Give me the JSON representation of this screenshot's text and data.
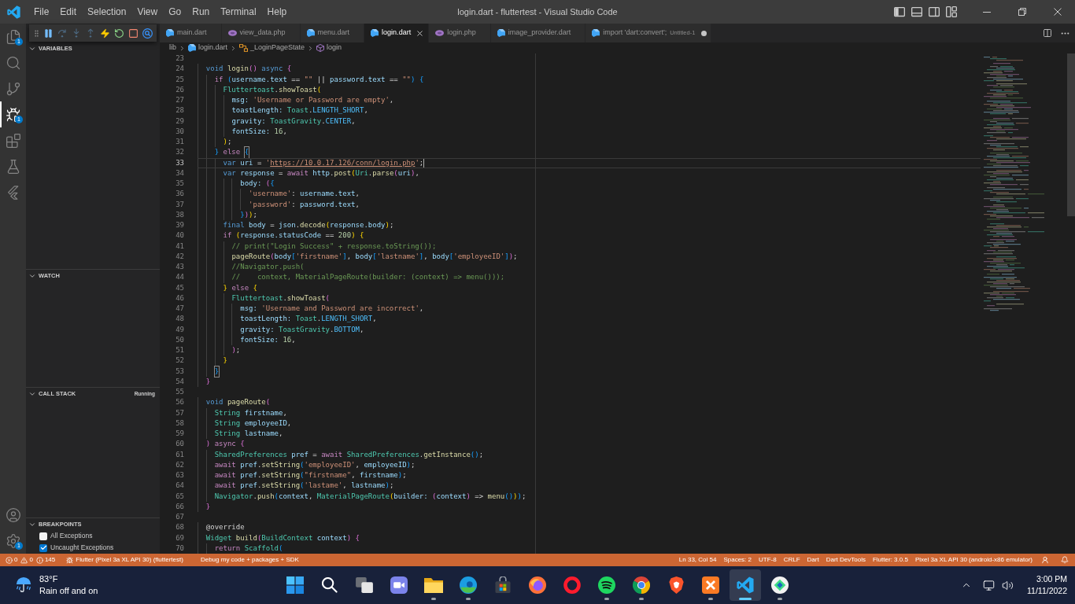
{
  "title_bar": {
    "menus": [
      "File",
      "Edit",
      "Selection",
      "View",
      "Go",
      "Run",
      "Terminal",
      "Help"
    ],
    "title": "login.dart - fluttertest - Visual Studio Code"
  },
  "activity_bar": {
    "items": [
      {
        "kind": "explorer",
        "selected": false,
        "badge": "1"
      },
      {
        "kind": "search",
        "selected": false
      },
      {
        "kind": "source-control",
        "selected": false
      },
      {
        "kind": "run-debug",
        "selected": true,
        "badge": "1"
      },
      {
        "kind": "extensions",
        "selected": false
      },
      {
        "kind": "testing",
        "selected": false
      },
      {
        "kind": "flutter",
        "selected": false
      }
    ],
    "bottom_items": [
      {
        "kind": "accounts"
      },
      {
        "kind": "settings",
        "badge": "1"
      }
    ]
  },
  "debug_toolbar": {
    "buttons": [
      {
        "kind": "pause",
        "disabled": false
      },
      {
        "kind": "step-over",
        "disabled": true
      },
      {
        "kind": "step-into",
        "disabled": true
      },
      {
        "kind": "step-out",
        "disabled": true
      },
      {
        "kind": "hot-reload",
        "disabled": false
      },
      {
        "kind": "restart",
        "disabled": false
      },
      {
        "kind": "stop",
        "disabled": false
      },
      {
        "kind": "devtools",
        "disabled": false
      }
    ]
  },
  "sidebar": {
    "sections": [
      {
        "title": "VARIABLES",
        "expanded": true
      },
      {
        "title": "WATCH",
        "expanded": true
      },
      {
        "title": "CALL STACK",
        "expanded": true,
        "status": "Running"
      },
      {
        "title": "BREAKPOINTS",
        "expanded": true,
        "items": [
          {
            "label": "All Exceptions",
            "checked": false
          },
          {
            "label": "Uncaught Exceptions",
            "checked": true
          }
        ]
      }
    ]
  },
  "tabs": [
    {
      "label": "main.dart",
      "kind": "dart",
      "selected": false,
      "dirty": false
    },
    {
      "label": "view_data.php",
      "kind": "php",
      "selected": false,
      "dirty": false
    },
    {
      "label": "menu.dart",
      "kind": "dart",
      "selected": false,
      "dirty": false
    },
    {
      "label": "login.dart",
      "kind": "dart",
      "selected": true,
      "dirty": false
    },
    {
      "label": "login.php",
      "kind": "php",
      "selected": false,
      "dirty": false
    },
    {
      "label": "image_provider.dart",
      "kind": "dart",
      "selected": false,
      "dirty": false
    },
    {
      "label": "import 'dart:convert';",
      "description": "Untitled-1",
      "kind": "dart",
      "selected": false,
      "dirty": true
    }
  ],
  "breadcrumbs": [
    {
      "label": "lib",
      "kind": "folder"
    },
    {
      "label": "login.dart",
      "kind": "dart"
    },
    {
      "label": "_LoginPageState",
      "kind": "class"
    },
    {
      "label": "login",
      "kind": "method"
    }
  ],
  "editor": {
    "lines": [
      {
        "number": "23",
        "current": false
      },
      {
        "number": "24",
        "current": false,
        "tokens": [
          {
            "text": "  void ",
            "kind": "keyword"
          },
          {
            "text": "login",
            "kind": "function"
          },
          {
            "text": "() ",
            "kind": "bracket2"
          },
          {
            "text": "async ",
            "kind": "keyword"
          },
          {
            "text": "{",
            "kind": "bracket2"
          }
        ]
      },
      {
        "number": "25",
        "current": false,
        "tokens": [
          {
            "text": "    if ",
            "kind": "control"
          },
          {
            "text": "(",
            "kind": "bracket3"
          },
          {
            "text": "username.text",
            "kind": "variable"
          },
          {
            "text": " == ",
            "kind": "plain"
          },
          {
            "text": "\"\"",
            "kind": "string"
          },
          {
            "text": " || ",
            "kind": "plain"
          },
          {
            "text": "password.text",
            "kind": "variable"
          },
          {
            "text": " == ",
            "kind": "plain"
          },
          {
            "text": "\"\"",
            "kind": "string"
          },
          {
            "text": ") ",
            "kind": "bracket3"
          },
          {
            "text": "{",
            "kind": "bracket3"
          }
        ]
      },
      {
        "number": "26",
        "current": false,
        "tokens": [
          {
            "text": "      Fluttertoast",
            "kind": "type"
          },
          {
            "text": ".",
            "kind": "plain"
          },
          {
            "text": "showToast",
            "kind": "function"
          },
          {
            "text": "(",
            "kind": "bracket1"
          }
        ]
      },
      {
        "number": "27",
        "current": false,
        "tokens": [
          {
            "text": "        msg: ",
            "kind": "variable"
          },
          {
            "text": "'Username or Password are empty'",
            "kind": "string"
          },
          {
            "text": ",",
            "kind": "plain"
          }
        ]
      },
      {
        "number": "28",
        "current": false,
        "tokens": [
          {
            "text": "        toastLength: ",
            "kind": "variable"
          },
          {
            "text": "Toast",
            "kind": "type"
          },
          {
            "text": ".",
            "kind": "plain"
          },
          {
            "text": "LENGTH_SHORT",
            "kind": "constant"
          },
          {
            "text": ",",
            "kind": "plain"
          }
        ]
      },
      {
        "number": "29",
        "current": false,
        "tokens": [
          {
            "text": "        gravity: ",
            "kind": "variable"
          },
          {
            "text": "ToastGravity",
            "kind": "type"
          },
          {
            "text": ".",
            "kind": "plain"
          },
          {
            "text": "CENTER",
            "kind": "constant"
          },
          {
            "text": ",",
            "kind": "plain"
          }
        ]
      },
      {
        "number": "30",
        "current": false,
        "tokens": [
          {
            "text": "        fontSize: ",
            "kind": "variable"
          },
          {
            "text": "16",
            "kind": "number"
          },
          {
            "text": ",",
            "kind": "plain"
          }
        ]
      },
      {
        "number": "31",
        "current": false,
        "tokens": [
          {
            "text": "      )",
            "kind": "bracket1"
          },
          {
            "text": ";",
            "kind": "plain"
          }
        ]
      },
      {
        "number": "32",
        "current": false,
        "tokens": [
          {
            "text": "    } ",
            "kind": "bracket3"
          },
          {
            "text": "else ",
            "kind": "control"
          },
          {
            "text": "{",
            "kind": "bracket_match"
          }
        ]
      },
      {
        "number": "33",
        "current": true,
        "tokens": [
          {
            "text": "      var ",
            "kind": "keyword"
          },
          {
            "text": "uri",
            "kind": "variable"
          },
          {
            "text": " = ",
            "kind": "plain"
          },
          {
            "text": "'",
            "kind": "string"
          },
          {
            "text": "https://10.0.17.126/conn/login.php",
            "kind": "link"
          },
          {
            "text": "'",
            "kind": "string"
          },
          {
            "text": ";",
            "kind": "plain"
          }
        ]
      },
      {
        "number": "34",
        "current": false,
        "tokens": [
          {
            "text": "      var ",
            "kind": "keyword"
          },
          {
            "text": "response",
            "kind": "variable"
          },
          {
            "text": " = ",
            "kind": "plain"
          },
          {
            "text": "await ",
            "kind": "control"
          },
          {
            "text": "http",
            "kind": "variable"
          },
          {
            "text": ".",
            "kind": "plain"
          },
          {
            "text": "post",
            "kind": "function"
          },
          {
            "text": "(",
            "kind": "bracket1"
          },
          {
            "text": "Uri",
            "kind": "type"
          },
          {
            "text": ".",
            "kind": "plain"
          },
          {
            "text": "parse",
            "kind": "function"
          },
          {
            "text": "(",
            "kind": "bracket2"
          },
          {
            "text": "uri",
            "kind": "variable"
          },
          {
            "text": ")",
            "kind": "bracket2"
          },
          {
            "text": ",",
            "kind": "plain"
          }
        ]
      },
      {
        "number": "35",
        "current": false,
        "tokens": [
          {
            "text": "          body: ",
            "kind": "variable"
          },
          {
            "text": "(",
            "kind": "bracket2"
          },
          {
            "text": "{",
            "kind": "bracket3"
          }
        ]
      },
      {
        "number": "36",
        "current": false,
        "tokens": [
          {
            "text": "            'username'",
            "kind": "string"
          },
          {
            "text": ": ",
            "kind": "plain"
          },
          {
            "text": "username.text",
            "kind": "variable"
          },
          {
            "text": ",",
            "kind": "plain"
          }
        ]
      },
      {
        "number": "37",
        "current": false,
        "tokens": [
          {
            "text": "            'password'",
            "kind": "string"
          },
          {
            "text": ": ",
            "kind": "plain"
          },
          {
            "text": "password.text",
            "kind": "variable"
          },
          {
            "text": ",",
            "kind": "plain"
          }
        ]
      },
      {
        "number": "38",
        "current": false,
        "tokens": [
          {
            "text": "          }",
            "kind": "bracket3"
          },
          {
            "text": ")",
            "kind": "bracket2"
          },
          {
            "text": ")",
            "kind": "bracket1"
          },
          {
            "text": ";",
            "kind": "plain"
          }
        ]
      },
      {
        "number": "39",
        "current": false,
        "tokens": [
          {
            "text": "      final ",
            "kind": "keyword"
          },
          {
            "text": "body",
            "kind": "variable"
          },
          {
            "text": " = ",
            "kind": "plain"
          },
          {
            "text": "json",
            "kind": "variable"
          },
          {
            "text": ".",
            "kind": "plain"
          },
          {
            "text": "decode",
            "kind": "function"
          },
          {
            "text": "(",
            "kind": "bracket1"
          },
          {
            "text": "response.body",
            "kind": "variable"
          },
          {
            "text": ")",
            "kind": "bracket1"
          },
          {
            "text": ";",
            "kind": "plain"
          }
        ]
      },
      {
        "number": "40",
        "current": false,
        "tokens": [
          {
            "text": "      if ",
            "kind": "control"
          },
          {
            "text": "(",
            "kind": "bracket1"
          },
          {
            "text": "response.statusCode",
            "kind": "variable"
          },
          {
            "text": " == ",
            "kind": "plain"
          },
          {
            "text": "200",
            "kind": "number"
          },
          {
            "text": ") ",
            "kind": "bracket1"
          },
          {
            "text": "{",
            "kind": "bracket1"
          }
        ]
      },
      {
        "number": "41",
        "current": false,
        "tokens": [
          {
            "text": "        // print(\"Login Success\" + response.toString());",
            "kind": "comment"
          }
        ]
      },
      {
        "number": "42",
        "current": false,
        "tokens": [
          {
            "text": "        pageRoute",
            "kind": "function"
          },
          {
            "text": "(",
            "kind": "bracket2"
          },
          {
            "text": "body",
            "kind": "variable"
          },
          {
            "text": "[",
            "kind": "bracket3"
          },
          {
            "text": "'firstname'",
            "kind": "string"
          },
          {
            "text": "]",
            "kind": "bracket3"
          },
          {
            "text": ", ",
            "kind": "plain"
          },
          {
            "text": "body",
            "kind": "variable"
          },
          {
            "text": "[",
            "kind": "bracket3"
          },
          {
            "text": "'lastname'",
            "kind": "string"
          },
          {
            "text": "]",
            "kind": "bracket3"
          },
          {
            "text": ", ",
            "kind": "plain"
          },
          {
            "text": "body",
            "kind": "variable"
          },
          {
            "text": "[",
            "kind": "bracket3"
          },
          {
            "text": "'employeeID'",
            "kind": "string"
          },
          {
            "text": "]",
            "kind": "bracket3"
          },
          {
            "text": ")",
            "kind": "bracket2"
          },
          {
            "text": ";",
            "kind": "plain"
          }
        ]
      },
      {
        "number": "43",
        "current": false,
        "tokens": [
          {
            "text": "        //Navigator.push(",
            "kind": "comment"
          }
        ]
      },
      {
        "number": "44",
        "current": false,
        "tokens": [
          {
            "text": "        //    context, MaterialPageRoute(builder: (context) => menu()));",
            "kind": "comment"
          }
        ]
      },
      {
        "number": "45",
        "current": false,
        "tokens": [
          {
            "text": "      } ",
            "kind": "bracket1"
          },
          {
            "text": "else ",
            "kind": "control"
          },
          {
            "text": "{",
            "kind": "bracket1"
          }
        ]
      },
      {
        "number": "46",
        "current": false,
        "tokens": [
          {
            "text": "        Fluttertoast",
            "kind": "type"
          },
          {
            "text": ".",
            "kind": "plain"
          },
          {
            "text": "showToast",
            "kind": "function"
          },
          {
            "text": "(",
            "kind": "bracket2"
          }
        ]
      },
      {
        "number": "47",
        "current": false,
        "tokens": [
          {
            "text": "          msg: ",
            "kind": "variable"
          },
          {
            "text": "'Username and Password are incorrect'",
            "kind": "string"
          },
          {
            "text": ",",
            "kind": "plain"
          }
        ]
      },
      {
        "number": "48",
        "current": false,
        "tokens": [
          {
            "text": "          toastLength: ",
            "kind": "variable"
          },
          {
            "text": "Toast",
            "kind": "type"
          },
          {
            "text": ".",
            "kind": "plain"
          },
          {
            "text": "LENGTH_SHORT",
            "kind": "constant"
          },
          {
            "text": ",",
            "kind": "plain"
          }
        ]
      },
      {
        "number": "49",
        "current": false,
        "tokens": [
          {
            "text": "          gravity: ",
            "kind": "variable"
          },
          {
            "text": "ToastGravity",
            "kind": "type"
          },
          {
            "text": ".",
            "kind": "plain"
          },
          {
            "text": "BOTTOM",
            "kind": "constant"
          },
          {
            "text": ",",
            "kind": "plain"
          }
        ]
      },
      {
        "number": "50",
        "current": false,
        "tokens": [
          {
            "text": "          fontSize: ",
            "kind": "variable"
          },
          {
            "text": "16",
            "kind": "number"
          },
          {
            "text": ",",
            "kind": "plain"
          }
        ]
      },
      {
        "number": "51",
        "current": false,
        "tokens": [
          {
            "text": "        )",
            "kind": "bracket2"
          },
          {
            "text": ";",
            "kind": "plain"
          }
        ]
      },
      {
        "number": "52",
        "current": false,
        "tokens": [
          {
            "text": "      }",
            "kind": "bracket1"
          }
        ]
      },
      {
        "number": "53",
        "current": false,
        "tokens": [
          {
            "text": "    }",
            "kind": "bracket_match"
          }
        ]
      },
      {
        "number": "54",
        "current": false,
        "tokens": [
          {
            "text": "  }",
            "kind": "bracket2"
          }
        ]
      },
      {
        "number": "55",
        "current": false
      },
      {
        "number": "56",
        "current": false,
        "tokens": [
          {
            "text": "  void ",
            "kind": "keyword"
          },
          {
            "text": "pageRoute",
            "kind": "function"
          },
          {
            "text": "(",
            "kind": "bracket2"
          }
        ]
      },
      {
        "number": "57",
        "current": false,
        "tokens": [
          {
            "text": "    String ",
            "kind": "type"
          },
          {
            "text": "firstname",
            "kind": "variable"
          },
          {
            "text": ",",
            "kind": "plain"
          }
        ]
      },
      {
        "number": "58",
        "current": false,
        "tokens": [
          {
            "text": "    String ",
            "kind": "type"
          },
          {
            "text": "employeeID",
            "kind": "variable"
          },
          {
            "text": ",",
            "kind": "plain"
          }
        ]
      },
      {
        "number": "59",
        "current": false,
        "tokens": [
          {
            "text": "    String ",
            "kind": "type"
          },
          {
            "text": "lastname",
            "kind": "variable"
          },
          {
            "text": ",",
            "kind": "plain"
          }
        ]
      },
      {
        "number": "60",
        "current": false,
        "tokens": [
          {
            "text": "  ) ",
            "kind": "bracket2"
          },
          {
            "text": "async ",
            "kind": "control"
          },
          {
            "text": "{",
            "kind": "bracket2"
          }
        ]
      },
      {
        "number": "61",
        "current": false,
        "tokens": [
          {
            "text": "    SharedPreferences ",
            "kind": "type"
          },
          {
            "text": "pref",
            "kind": "variable"
          },
          {
            "text": " = ",
            "kind": "plain"
          },
          {
            "text": "await ",
            "kind": "control"
          },
          {
            "text": "SharedPreferences",
            "kind": "type"
          },
          {
            "text": ".",
            "kind": "plain"
          },
          {
            "text": "getInstance",
            "kind": "function"
          },
          {
            "text": "()",
            "kind": "bracket3"
          },
          {
            "text": ";",
            "kind": "plain"
          }
        ]
      },
      {
        "number": "62",
        "current": false,
        "tokens": [
          {
            "text": "    await ",
            "kind": "control"
          },
          {
            "text": "pref",
            "kind": "variable"
          },
          {
            "text": ".",
            "kind": "plain"
          },
          {
            "text": "setString",
            "kind": "function"
          },
          {
            "text": "(",
            "kind": "bracket3"
          },
          {
            "text": "'employeeID'",
            "kind": "string"
          },
          {
            "text": ", ",
            "kind": "plain"
          },
          {
            "text": "employeeID",
            "kind": "variable"
          },
          {
            "text": ")",
            "kind": "bracket3"
          },
          {
            "text": ";",
            "kind": "plain"
          }
        ]
      },
      {
        "number": "63",
        "current": false,
        "tokens": [
          {
            "text": "    await ",
            "kind": "control"
          },
          {
            "text": "pref",
            "kind": "variable"
          },
          {
            "text": ".",
            "kind": "plain"
          },
          {
            "text": "setString",
            "kind": "function"
          },
          {
            "text": "(",
            "kind": "bracket3"
          },
          {
            "text": "\"firstname\"",
            "kind": "string"
          },
          {
            "text": ", ",
            "kind": "plain"
          },
          {
            "text": "firstname",
            "kind": "variable"
          },
          {
            "text": ")",
            "kind": "bracket3"
          },
          {
            "text": ";",
            "kind": "plain"
          }
        ]
      },
      {
        "number": "64",
        "current": false,
        "tokens": [
          {
            "text": "    await ",
            "kind": "control"
          },
          {
            "text": "pref",
            "kind": "variable"
          },
          {
            "text": ".",
            "kind": "plain"
          },
          {
            "text": "setString",
            "kind": "function"
          },
          {
            "text": "(",
            "kind": "bracket3"
          },
          {
            "text": "'lastame'",
            "kind": "string"
          },
          {
            "text": ", ",
            "kind": "plain"
          },
          {
            "text": "lastname",
            "kind": "variable"
          },
          {
            "text": ")",
            "kind": "bracket3"
          },
          {
            "text": ";",
            "kind": "plain"
          }
        ]
      },
      {
        "number": "65",
        "current": false,
        "tokens": [
          {
            "text": "    Navigator",
            "kind": "type"
          },
          {
            "text": ".",
            "kind": "plain"
          },
          {
            "text": "push",
            "kind": "function"
          },
          {
            "text": "(",
            "kind": "bracket3"
          },
          {
            "text": "context",
            "kind": "variable"
          },
          {
            "text": ", ",
            "kind": "plain"
          },
          {
            "text": "MaterialPageRoute",
            "kind": "type"
          },
          {
            "text": "(",
            "kind": "bracket1"
          },
          {
            "text": "builder: ",
            "kind": "variable"
          },
          {
            "text": "(",
            "kind": "bracket2"
          },
          {
            "text": "context",
            "kind": "variable"
          },
          {
            "text": ") ",
            "kind": "bracket2"
          },
          {
            "text": "=> ",
            "kind": "plain"
          },
          {
            "text": "menu",
            "kind": "function"
          },
          {
            "text": "()",
            "kind": "bracket3"
          },
          {
            "text": ")",
            "kind": "bracket1"
          },
          {
            "text": ")",
            "kind": "bracket3"
          },
          {
            "text": ";",
            "kind": "plain"
          }
        ]
      },
      {
        "number": "66",
        "current": false,
        "tokens": [
          {
            "text": "  }",
            "kind": "bracket2"
          }
        ]
      },
      {
        "number": "67",
        "current": false
      },
      {
        "number": "68",
        "current": false,
        "tokens": [
          {
            "text": "  @override",
            "kind": "plain"
          }
        ]
      },
      {
        "number": "69",
        "current": false,
        "tokens": [
          {
            "text": "  Widget ",
            "kind": "type"
          },
          {
            "text": "build",
            "kind": "function"
          },
          {
            "text": "(",
            "kind": "bracket2"
          },
          {
            "text": "BuildContext ",
            "kind": "type"
          },
          {
            "text": "context",
            "kind": "variable"
          },
          {
            "text": ") ",
            "kind": "bracket2"
          },
          {
            "text": "{",
            "kind": "bracket2"
          }
        ]
      },
      {
        "number": "70",
        "current": false,
        "tokens": [
          {
            "text": "    return ",
            "kind": "control"
          },
          {
            "text": "Scaffold",
            "kind": "type"
          },
          {
            "text": "(",
            "kind": "bracket3"
          }
        ]
      }
    ]
  },
  "status_bar": {
    "problems": {
      "errors": "0",
      "warnings": "0",
      "infos": "145"
    },
    "session": "Flutter (Pixel 3a XL API 30) (fluttertest)",
    "debug_mode": "Debug my code + packages + SDK",
    "right_items": [
      "Ln 33, Col 54",
      "Spaces: 2",
      "UTF-8",
      "CRLF",
      "Dart",
      "Dart DevTools",
      "Flutter: 3.0.5",
      "Pixel 3a XL API 30 (android-x86 emulator)"
    ]
  },
  "taskbar": {
    "weather": {
      "temperature": "83°F",
      "condition": "Rain off and on"
    },
    "apps": [
      {
        "kind": "start",
        "running": false,
        "active": false
      },
      {
        "kind": "search",
        "running": false,
        "active": false
      },
      {
        "kind": "task-view",
        "running": false,
        "active": false
      },
      {
        "kind": "chat",
        "running": false,
        "active": false
      },
      {
        "kind": "file-explorer",
        "running": true,
        "active": false
      },
      {
        "kind": "edge",
        "running": true,
        "active": false
      },
      {
        "kind": "store",
        "running": false,
        "active": false
      },
      {
        "kind": "firefox",
        "running": false,
        "active": false
      },
      {
        "kind": "opera",
        "running": false,
        "active": false
      },
      {
        "kind": "spotify",
        "running": true,
        "active": false
      },
      {
        "kind": "chrome",
        "running": true,
        "active": false
      },
      {
        "kind": "brave",
        "running": false,
        "active": false
      },
      {
        "kind": "xampp",
        "running": true,
        "active": false
      },
      {
        "kind": "vscode",
        "running": true,
        "active": true
      },
      {
        "kind": "emulator",
        "running": true,
        "active": false
      }
    ],
    "clock": {
      "time": "3:00 PM",
      "date": "11/11/2022"
    }
  }
}
